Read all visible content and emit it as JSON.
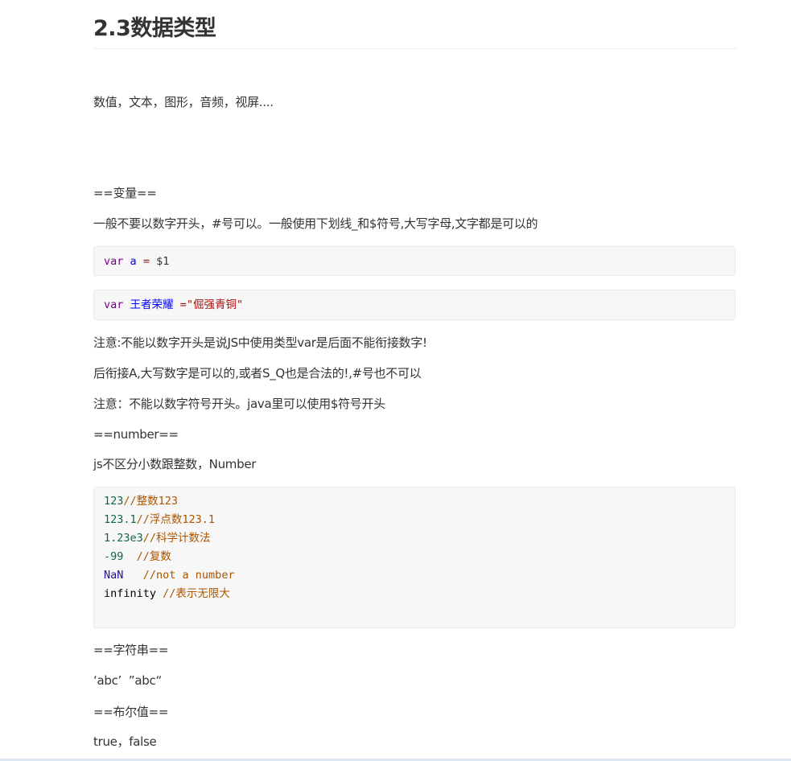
{
  "title": "2.3数据类型",
  "intro": "数值，文本，图形，音频，视屏....",
  "variables": {
    "heading": "==变量==",
    "rule": "一般不要以数字开头，#号可以。一般使用下划线_和$符号,大写字母,文字都是可以的",
    "code1": {
      "kw": "var",
      "name": "a",
      "op": "=",
      "value": "$1"
    },
    "code2": {
      "kw": "var",
      "name": "王者荣耀",
      "op": "=",
      "value": "\"倔强青铜\""
    },
    "note1": "注意:不能以数字开头是说JS中使用类型var是后面不能衔接数字!",
    "note2": "后衔接A,大写数字是可以的,或者S_Q也是合法的!,#号也不可以",
    "note3": "注意：不能以数字符号开头。java里可以使用$符号开头"
  },
  "number": {
    "heading": "==number==",
    "desc": "js不区分小数跟整数，Number",
    "lines": [
      {
        "value": "123",
        "value_type": "num",
        "gap": "",
        "comment": "//整数123"
      },
      {
        "value": "123.1",
        "value_type": "num",
        "gap": "",
        "comment": "//浮点数123.1"
      },
      {
        "value": "1.23e3",
        "value_type": "num",
        "gap": "",
        "comment": "//科学计数法"
      },
      {
        "value": "-99",
        "value_type": "num",
        "gap": "  ",
        "comment": "//复数"
      },
      {
        "value": "NaN",
        "value_type": "atom",
        "gap": "   ",
        "comment": "//not a number"
      },
      {
        "value": "infinity",
        "value_type": "plain",
        "gap": " ",
        "comment": "//表示无限大"
      }
    ]
  },
  "string": {
    "heading": "==字符串==",
    "example": "‘abc’  ”abc“"
  },
  "boolean": {
    "heading": "==布尔值==",
    "example": "true，false"
  },
  "colors": {
    "keyword": "#770088",
    "variable": "#0000ff",
    "string": "#aa1111",
    "number": "#116644",
    "comment": "#aa5500",
    "atom": "#221199"
  }
}
